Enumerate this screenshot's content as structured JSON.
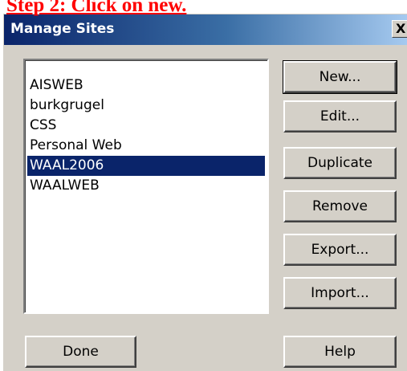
{
  "caption": "Step 2: Click on new.",
  "dialog": {
    "title": "Manage Sites",
    "close_label": "X"
  },
  "sites": {
    "items": [
      {
        "label": "AISWEB",
        "selected": false
      },
      {
        "label": "burkgrugel",
        "selected": false
      },
      {
        "label": "CSS",
        "selected": false
      },
      {
        "label": "Personal Web",
        "selected": false
      },
      {
        "label": "WAAL2006",
        "selected": true
      },
      {
        "label": "WAALWEB",
        "selected": false
      }
    ]
  },
  "buttons": {
    "new": "New...",
    "edit": "Edit...",
    "duplicate": "Duplicate",
    "remove": "Remove",
    "export": "Export...",
    "import": "Import...",
    "done": "Done",
    "help": "Help"
  },
  "colors": {
    "caption": "#ff0000",
    "title_bar_start": "#0a246a",
    "title_bar_end": "#a6caf0",
    "selection": "#0a246a",
    "dialog_face": "#d4d0c8"
  }
}
